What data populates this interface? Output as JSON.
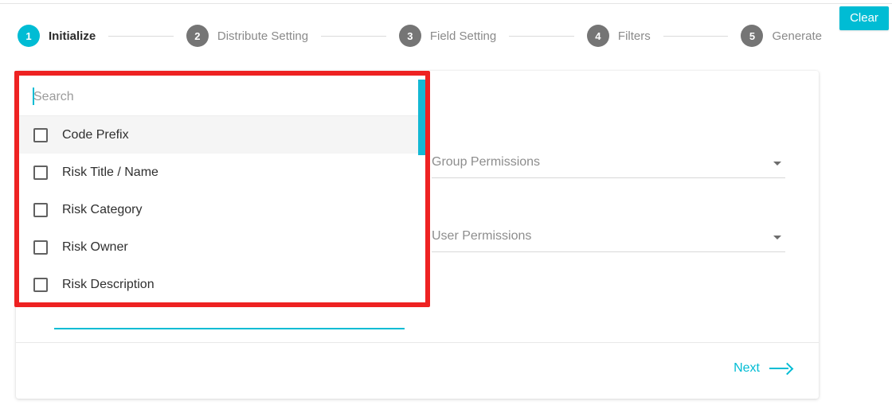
{
  "theme": {
    "accent": "#00bcd4",
    "highlight_border": "#ee2222",
    "step_inactive": "#757575",
    "card_bg": "#ffffff"
  },
  "header": {
    "clear_label": "Clear"
  },
  "stepper": {
    "steps": [
      {
        "number": "1",
        "label": "Initialize",
        "active": true
      },
      {
        "number": "2",
        "label": "Distribute Setting",
        "active": false
      },
      {
        "number": "3",
        "label": "Field Setting",
        "active": false
      },
      {
        "number": "4",
        "label": "Filters",
        "active": false
      },
      {
        "number": "5",
        "label": "Generate",
        "active": false
      }
    ]
  },
  "dropdown": {
    "search_placeholder": "Search",
    "search_value": "",
    "items": [
      {
        "label": "Code Prefix",
        "checked": false
      },
      {
        "label": "Risk Title / Name",
        "checked": false
      },
      {
        "label": "Risk Category",
        "checked": false
      },
      {
        "label": "Risk Owner",
        "checked": false
      },
      {
        "label": "Risk Description",
        "checked": false
      }
    ]
  },
  "form": {
    "group_permissions_label": "Group Permissions",
    "group_permissions_value": "",
    "user_permissions_label": "User Permissions",
    "user_permissions_value": ""
  },
  "footer": {
    "next_label": "Next"
  }
}
